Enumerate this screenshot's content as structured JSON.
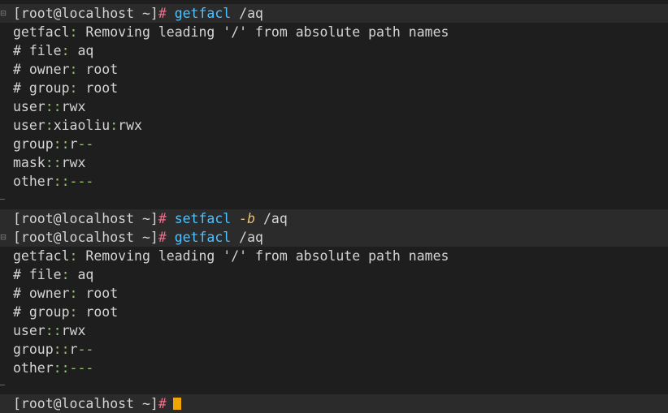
{
  "prompt": "[root@localhost ~]",
  "prompt_symbol": "#",
  "gutter_glyph": "⊟",
  "commands": [
    {
      "cmd": "getfacl",
      "args": " /aq"
    },
    {
      "cmd": "setfacl",
      "flag": "-b",
      "args": " /aq"
    },
    {
      "cmd": "getfacl",
      "args": " /aq"
    }
  ],
  "output1": {
    "notice_prefix": "getfacl",
    "notice_text": " Removing leading '/' from absolute path names",
    "file_key": "# file",
    "file_val": " aq",
    "owner_key": "# owner",
    "owner_val": " root",
    "group_key": "# group",
    "group_val": " root",
    "acl": [
      {
        "tag": "user",
        "qual": "",
        "perm": "rwx"
      },
      {
        "tag": "user",
        "qual": "xiaoliu",
        "perm": "rwx"
      },
      {
        "tag": "group",
        "qual": "",
        "perm": "r",
        "dash": "--"
      },
      {
        "tag": "mask",
        "qual": "",
        "perm": "rwx"
      },
      {
        "tag": "other",
        "qual": "",
        "perm": "",
        "dash": "---"
      }
    ]
  },
  "output2": {
    "notice_prefix": "getfacl",
    "notice_text": " Removing leading '/' from absolute path names",
    "file_key": "# file",
    "file_val": " aq",
    "owner_key": "# owner",
    "owner_val": " root",
    "group_key": "# group",
    "group_val": " root",
    "acl": [
      {
        "tag": "user",
        "qual": "",
        "perm": "rwx"
      },
      {
        "tag": "group",
        "qual": "",
        "perm": "r",
        "dash": "--"
      },
      {
        "tag": "other",
        "qual": "",
        "perm": "",
        "dash": "---"
      }
    ]
  },
  "colors": {
    "background": "#1e1e1e",
    "prompt_highlight": "#2b2b2b",
    "command": "#4fc1ff",
    "hash": "#f06c8a",
    "flag": "#e5c07b",
    "cursor": "#f0a500"
  }
}
